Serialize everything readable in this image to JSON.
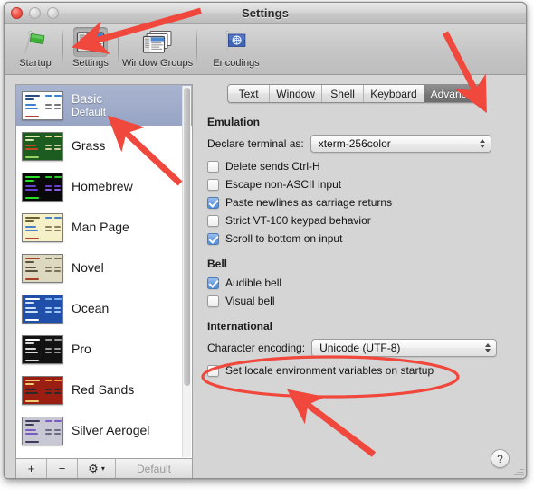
{
  "window": {
    "title": "Settings",
    "traffic_lights": [
      "close",
      "minimize",
      "zoom"
    ]
  },
  "toolbar": {
    "items": [
      {
        "label": "Startup",
        "icon": "green-flag-icon",
        "selected": false
      },
      {
        "label": "Settings",
        "icon": "settings-window-icon",
        "selected": true
      },
      {
        "label": "Window Groups",
        "icon": "window-groups-icon",
        "selected": false
      },
      {
        "label": "Encodings",
        "icon": "un-flag-icon",
        "selected": false
      }
    ]
  },
  "sidebar": {
    "profiles": [
      {
        "name": "Basic",
        "subtitle": "Default",
        "selected": true,
        "bg": "#ffffff",
        "fg": "#2a4a80",
        "accent": "#3f7fd0"
      },
      {
        "name": "Grass",
        "subtitle": "",
        "selected": false,
        "bg": "#1d5c20",
        "fg": "#d7e8b0",
        "accent": "#c24a20"
      },
      {
        "name": "Homebrew",
        "subtitle": "",
        "selected": false,
        "bg": "#080808",
        "fg": "#28e028",
        "accent": "#6a3fd0"
      },
      {
        "name": "Man Page",
        "subtitle": "",
        "selected": false,
        "bg": "#f6f0c8",
        "fg": "#4a4424",
        "accent": "#4d7fc4"
      },
      {
        "name": "Novel",
        "subtitle": "",
        "selected": false,
        "bg": "#ddd9c0",
        "fg": "#5a5240",
        "accent": "#a4402a"
      },
      {
        "name": "Ocean",
        "subtitle": "",
        "selected": false,
        "bg": "#1f4fa8",
        "fg": "#cfe0fa",
        "accent": "#7fb2ef"
      },
      {
        "name": "Pro",
        "subtitle": "",
        "selected": false,
        "bg": "#121212",
        "fg": "#dadada",
        "accent": "#9a9a9a"
      },
      {
        "name": "Red Sands",
        "subtitle": "",
        "selected": false,
        "bg": "#9b1e12",
        "fg": "#f0c870",
        "accent": "#f0a030"
      },
      {
        "name": "Silver Aerogel",
        "subtitle": "",
        "selected": false,
        "bg": "#c8c8d4",
        "fg": "#3c3c58",
        "accent": "#7a5cc0"
      }
    ],
    "buttons": {
      "add": "+",
      "remove": "−",
      "gear": "⚙",
      "gear_arrow": "▾",
      "default": "Default"
    }
  },
  "tabs": [
    {
      "label": "Text",
      "active": false
    },
    {
      "label": "Window",
      "active": false
    },
    {
      "label": "Shell",
      "active": false
    },
    {
      "label": "Keyboard",
      "active": false
    },
    {
      "label": "Advanced",
      "active": true
    }
  ],
  "panel": {
    "emulation": {
      "title": "Emulation",
      "terminal_label": "Declare terminal as:",
      "terminal_value": "xterm-256color",
      "checkboxes": [
        {
          "label": "Delete sends Ctrl-H",
          "checked": false
        },
        {
          "label": "Escape non-ASCII input",
          "checked": false
        },
        {
          "label": "Paste newlines as carriage returns",
          "checked": true
        },
        {
          "label": "Strict VT-100 keypad behavior",
          "checked": false
        },
        {
          "label": "Scroll to bottom on input",
          "checked": true
        }
      ]
    },
    "bell": {
      "title": "Bell",
      "checkboxes": [
        {
          "label": "Audible bell",
          "checked": true
        },
        {
          "label": "Visual bell",
          "checked": false
        }
      ]
    },
    "international": {
      "title": "International",
      "encoding_label": "Character encoding:",
      "encoding_value": "Unicode (UTF-8)",
      "checkboxes": [
        {
          "label": "Set locale environment variables on startup",
          "checked": false
        }
      ]
    },
    "help_button": "?"
  },
  "annotations": {
    "color": "#f0483c",
    "arrows": [
      {
        "name": "arrow-to-settings-toolbar-item"
      },
      {
        "name": "arrow-to-advanced-tab"
      },
      {
        "name": "arrow-to-basic-profile"
      },
      {
        "name": "arrow-to-locale-checkbox"
      }
    ],
    "ellipse": {
      "name": "highlight-ellipse-locale-checkbox"
    }
  }
}
